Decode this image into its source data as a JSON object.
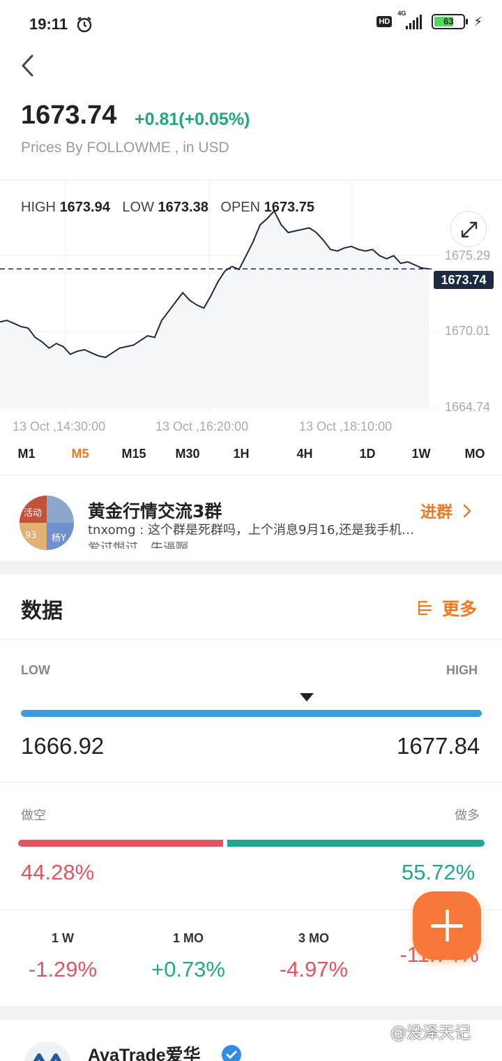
{
  "status_bar": {
    "time": "19:11",
    "hd": "HD",
    "network": "4G",
    "battery": "63"
  },
  "quote": {
    "price": "1673.74",
    "change": "+0.81(+0.05%)",
    "source": "Prices By FOLLOWME , in USD",
    "high_label": "HIGH",
    "high": "1673.94",
    "low_label": "LOW",
    "low": "1673.38",
    "open_label": "OPEN",
    "open": "1673.75",
    "up_color": "#1fa87f"
  },
  "chart_data": {
    "type": "line",
    "x": [
      "13 Oct ,14:30:00",
      "13 Oct ,16:20:00",
      "13 Oct ,18:10:00"
    ],
    "x_tick_labels": [
      "13 Oct ,14:30:00",
      "13 Oct ,16:20:00",
      "13 Oct ,18:10:00"
    ],
    "y_tick_labels": [
      "1675.29",
      "1670.01",
      "1664.74"
    ],
    "ylim": [
      1664.74,
      1677.6
    ],
    "current_price_label": "1673.74",
    "current_price": 1673.74,
    "series_values": [
      1670.3,
      1670.4,
      1670.2,
      1670.0,
      1669.9,
      1669.3,
      1669.0,
      1668.6,
      1668.9,
      1668.7,
      1668.2,
      1668.4,
      1668.5,
      1668.3,
      1668.1,
      1668.0,
      1668.3,
      1668.6,
      1668.7,
      1668.8,
      1669.1,
      1669.4,
      1669.3,
      1670.4,
      1671.0,
      1671.6,
      1672.2,
      1671.7,
      1671.4,
      1671.2,
      1672.0,
      1672.9,
      1673.6,
      1673.9,
      1673.7,
      1674.6,
      1675.5,
      1676.6,
      1677.0,
      1677.5,
      1676.6,
      1676.1,
      1676.2,
      1676.3,
      1676.4,
      1676.1,
      1675.6,
      1675.0,
      1674.9,
      1675.1,
      1675.2,
      1675.0,
      1674.9,
      1675.0,
      1674.6,
      1674.4,
      1674.6,
      1674.1,
      1674.2,
      1674.0,
      1673.8,
      1673.74
    ]
  },
  "timeframes": [
    "M1",
    "M5",
    "M15",
    "M30",
    "1H",
    "4H",
    "1D",
    "1W",
    "MO"
  ],
  "active_timeframe": "M5",
  "group": {
    "avatar_tags": [
      "活动",
      "93",
      "杨Y"
    ],
    "name": "黄金行情交流3群",
    "message": "tnxomg : 这个群是死群吗，上个消息9月16,还是我手机…",
    "message2": "爱过恨过，牛逼啊",
    "join_label": "进群"
  },
  "data_section": {
    "title": "数据",
    "more_label": "更多",
    "low_label": "LOW",
    "high_label": "HIGH",
    "low_value": "1666.92",
    "high_value": "1677.84",
    "current_position": 0.62
  },
  "sentiment": {
    "short_label": "做空",
    "long_label": "做多",
    "short_pct": "44.28%",
    "long_pct": "55.72%",
    "short_fraction": 0.4428,
    "short_color": "#e25563",
    "long_color": "#1fa88f"
  },
  "performance": [
    {
      "period": "1 W",
      "value": "-1.29%",
      "dir": "neg"
    },
    {
      "period": "1 MO",
      "value": "+0.73%",
      "dir": "pos"
    },
    {
      "period": "3 MO",
      "value": "-4.97%",
      "dir": "neg"
    },
    {
      "period": "",
      "value": "-11.74%",
      "dir": "neg"
    }
  ],
  "fab": {
    "icon": "plus-icon",
    "color": "#f7783a"
  },
  "broker": {
    "name": "AvaTrade爱华"
  },
  "watermark": "@没泽天记"
}
